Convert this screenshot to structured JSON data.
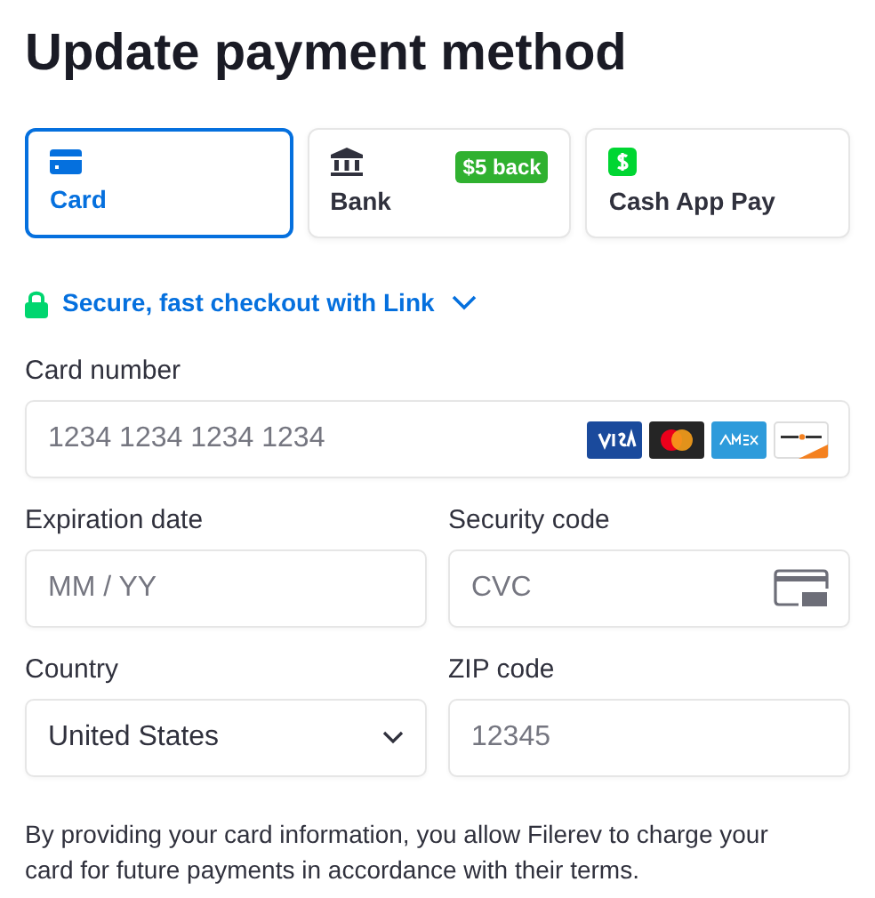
{
  "title": "Update payment method",
  "tabs": [
    {
      "kind": "card",
      "label": "Card",
      "selected": true
    },
    {
      "kind": "bank",
      "label": "Bank",
      "selected": false,
      "badge": "$5 back"
    },
    {
      "kind": "cashapp",
      "label": "Cash App Pay",
      "selected": false
    }
  ],
  "link": {
    "text": "Secure, fast checkout with Link",
    "expanded": false
  },
  "card_number": {
    "label": "Card number",
    "placeholder": "1234 1234 1234 1234"
  },
  "expiration": {
    "label": "Expiration date",
    "placeholder": "MM / YY"
  },
  "security_code": {
    "label": "Security code",
    "placeholder": "CVC"
  },
  "country": {
    "label": "Country",
    "value": "United States"
  },
  "zip": {
    "label": "ZIP code",
    "placeholder": "12345"
  },
  "notice": "By providing your card information, you allow Filerev to charge your card for future payments in accordance with their terms."
}
